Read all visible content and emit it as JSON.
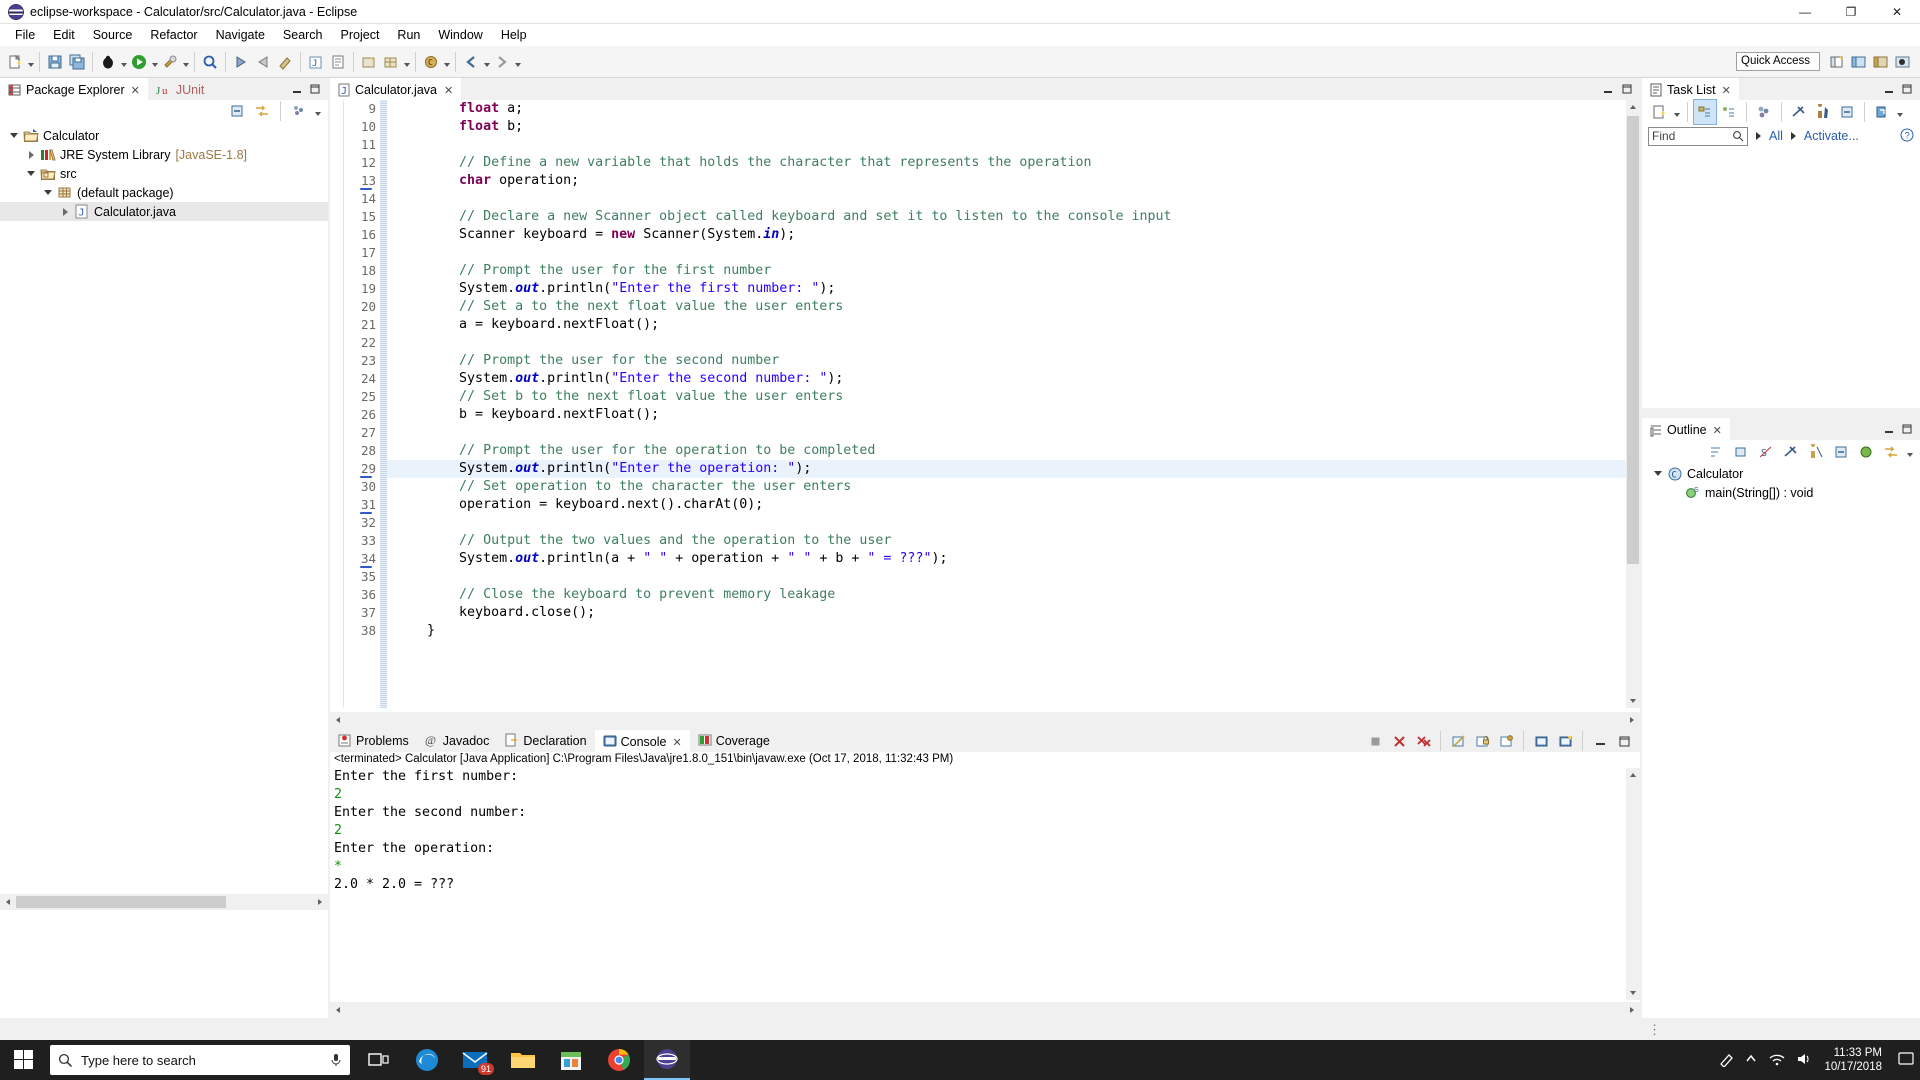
{
  "window": {
    "title": "eclipse-workspace - Calculator/src/Calculator.java - Eclipse",
    "minimize": "—",
    "maximize": "❐",
    "close": "✕"
  },
  "menubar": {
    "items": [
      "File",
      "Edit",
      "Source",
      "Refactor",
      "Navigate",
      "Search",
      "Project",
      "Run",
      "Window",
      "Help"
    ]
  },
  "toolbar": {
    "quick_access_placeholder": "Quick Access"
  },
  "package_explorer": {
    "tabs": [
      {
        "label": "Package Explorer",
        "active": true,
        "icon": "package-explorer-icon"
      },
      {
        "label": "JUnit",
        "active": false,
        "icon": "junit-icon"
      }
    ],
    "tree": [
      {
        "label": "Calculator",
        "sub": "",
        "depth": 0,
        "twisty": "down",
        "icon": "java-project-icon",
        "selected": false
      },
      {
        "label": "JRE System Library",
        "sub": "[JavaSE-1.8]",
        "depth": 1,
        "twisty": "right",
        "icon": "jre-library-icon",
        "selected": false
      },
      {
        "label": "src",
        "sub": "",
        "depth": 1,
        "twisty": "down",
        "icon": "source-folder-icon",
        "selected": false
      },
      {
        "label": "(default package)",
        "sub": "",
        "depth": 2,
        "twisty": "down",
        "icon": "package-icon",
        "selected": false
      },
      {
        "label": "Calculator.java",
        "sub": "",
        "depth": 3,
        "twisty": "right",
        "icon": "java-file-icon",
        "selected": true
      }
    ]
  },
  "editor": {
    "tab": {
      "label": "Calculator.java",
      "icon": "java-file-icon"
    },
    "first_line_number": 9,
    "current_line": 29,
    "changed_lines": [
      13,
      29,
      31,
      34
    ],
    "lines": [
      {
        "n": 9,
        "tokens": [
          {
            "t": "        ",
            "c": ""
          },
          {
            "t": "float",
            "c": "kw"
          },
          {
            "t": " a;",
            "c": ""
          }
        ]
      },
      {
        "n": 10,
        "tokens": [
          {
            "t": "        ",
            "c": ""
          },
          {
            "t": "float",
            "c": "kw"
          },
          {
            "t": " b;",
            "c": ""
          }
        ]
      },
      {
        "n": 11,
        "tokens": []
      },
      {
        "n": 12,
        "tokens": [
          {
            "t": "        ",
            "c": ""
          },
          {
            "t": "// Define a new variable that holds the character that represents the operation",
            "c": "cm"
          }
        ]
      },
      {
        "n": 13,
        "tokens": [
          {
            "t": "        ",
            "c": ""
          },
          {
            "t": "char",
            "c": "kw"
          },
          {
            "t": " operation;",
            "c": ""
          }
        ]
      },
      {
        "n": 14,
        "tokens": []
      },
      {
        "n": 15,
        "tokens": [
          {
            "t": "        ",
            "c": ""
          },
          {
            "t": "// Declare a new Scanner object called keyboard and set it to listen to the console input",
            "c": "cm"
          }
        ]
      },
      {
        "n": 16,
        "tokens": [
          {
            "t": "        Scanner keyboard = ",
            "c": ""
          },
          {
            "t": "new",
            "c": "kw"
          },
          {
            "t": " Scanner(System.",
            "c": ""
          },
          {
            "t": "in",
            "c": "fld"
          },
          {
            "t": ");",
            "c": ""
          }
        ]
      },
      {
        "n": 17,
        "tokens": []
      },
      {
        "n": 18,
        "tokens": [
          {
            "t": "        ",
            "c": ""
          },
          {
            "t": "// Prompt the user for the first number",
            "c": "cm"
          }
        ]
      },
      {
        "n": 19,
        "tokens": [
          {
            "t": "        System.",
            "c": ""
          },
          {
            "t": "out",
            "c": "fld"
          },
          {
            "t": ".println(",
            "c": ""
          },
          {
            "t": "\"Enter the first number: \"",
            "c": "st"
          },
          {
            "t": ");",
            "c": ""
          }
        ]
      },
      {
        "n": 20,
        "tokens": [
          {
            "t": "        ",
            "c": ""
          },
          {
            "t": "// Set a to the next float value the user enters",
            "c": "cm"
          }
        ]
      },
      {
        "n": 21,
        "tokens": [
          {
            "t": "        a = keyboard.nextFloat();",
            "c": ""
          }
        ]
      },
      {
        "n": 22,
        "tokens": []
      },
      {
        "n": 23,
        "tokens": [
          {
            "t": "        ",
            "c": ""
          },
          {
            "t": "// Prompt the user for the second number",
            "c": "cm"
          }
        ]
      },
      {
        "n": 24,
        "tokens": [
          {
            "t": "        System.",
            "c": ""
          },
          {
            "t": "out",
            "c": "fld"
          },
          {
            "t": ".println(",
            "c": ""
          },
          {
            "t": "\"Enter the second number: \"",
            "c": "st"
          },
          {
            "t": ");",
            "c": ""
          }
        ]
      },
      {
        "n": 25,
        "tokens": [
          {
            "t": "        ",
            "c": ""
          },
          {
            "t": "// Set b to the next float value the user enters",
            "c": "cm"
          }
        ]
      },
      {
        "n": 26,
        "tokens": [
          {
            "t": "        b = keyboard.nextFloat();",
            "c": ""
          }
        ]
      },
      {
        "n": 27,
        "tokens": []
      },
      {
        "n": 28,
        "tokens": [
          {
            "t": "        ",
            "c": ""
          },
          {
            "t": "// Prompt the user for the operation to be completed",
            "c": "cm"
          }
        ]
      },
      {
        "n": 29,
        "tokens": [
          {
            "t": "        System.",
            "c": ""
          },
          {
            "t": "out",
            "c": "fld"
          },
          {
            "t": ".println(",
            "c": ""
          },
          {
            "t": "\"Enter the operation: \"",
            "c": "st"
          },
          {
            "t": ");",
            "c": ""
          }
        ]
      },
      {
        "n": 30,
        "tokens": [
          {
            "t": "        ",
            "c": ""
          },
          {
            "t": "// Set operation to the character the user enters",
            "c": "cm"
          }
        ]
      },
      {
        "n": 31,
        "tokens": [
          {
            "t": "        operation = keyboard.next().charAt(0);",
            "c": ""
          }
        ]
      },
      {
        "n": 32,
        "tokens": []
      },
      {
        "n": 33,
        "tokens": [
          {
            "t": "        ",
            "c": ""
          },
          {
            "t": "// Output the two values and the operation to the user",
            "c": "cm"
          }
        ]
      },
      {
        "n": 34,
        "tokens": [
          {
            "t": "        System.",
            "c": ""
          },
          {
            "t": "out",
            "c": "fld"
          },
          {
            "t": ".println(a + ",
            "c": ""
          },
          {
            "t": "\" \"",
            "c": "st"
          },
          {
            "t": " + operation + ",
            "c": ""
          },
          {
            "t": "\" \"",
            "c": "st"
          },
          {
            "t": " + b + ",
            "c": ""
          },
          {
            "t": "\" = ???\"",
            "c": "st"
          },
          {
            "t": ");",
            "c": ""
          }
        ]
      },
      {
        "n": 35,
        "tokens": []
      },
      {
        "n": 36,
        "tokens": [
          {
            "t": "        ",
            "c": ""
          },
          {
            "t": "// Close the keyboard to prevent memory leakage",
            "c": "cm"
          }
        ]
      },
      {
        "n": 37,
        "tokens": [
          {
            "t": "        keyboard.close();",
            "c": ""
          }
        ]
      },
      {
        "n": 38,
        "tokens": [
          {
            "t": "    }",
            "c": ""
          }
        ]
      }
    ]
  },
  "console": {
    "tabs": [
      {
        "label": "Problems",
        "active": false,
        "icon": "problems-icon"
      },
      {
        "label": "Javadoc",
        "active": false,
        "icon": "javadoc-icon"
      },
      {
        "label": "Declaration",
        "active": false,
        "icon": "declaration-icon"
      },
      {
        "label": "Console",
        "active": true,
        "icon": "console-icon"
      },
      {
        "label": "Coverage",
        "active": false,
        "icon": "coverage-icon"
      }
    ],
    "header": "<terminated> Calculator [Java Application] C:\\Program Files\\Java\\jre1.8.0_151\\bin\\javaw.exe (Oct 17, 2018, 11:32:43 PM)",
    "output": [
      {
        "text": "Enter the first number: ",
        "input": false
      },
      {
        "text": "2",
        "input": true
      },
      {
        "text": "Enter the second number: ",
        "input": false
      },
      {
        "text": "2",
        "input": true
      },
      {
        "text": "Enter the operation: ",
        "input": false
      },
      {
        "text": "*",
        "input": true
      },
      {
        "text": "2.0 * 2.0 = ???",
        "input": false
      }
    ]
  },
  "task_list": {
    "tab": {
      "label": "Task List",
      "icon": "task-list-icon"
    },
    "find_placeholder": "Find",
    "all_label": "All",
    "activate_label": "Activate..."
  },
  "outline": {
    "tab": {
      "label": "Outline",
      "icon": "outline-icon"
    },
    "rows": [
      {
        "label": "Calculator",
        "depth": 0,
        "twisty": "down",
        "icon": "java-class-icon"
      },
      {
        "label": "main(String[]) : void",
        "depth": 1,
        "twisty": "none",
        "icon": "method-public-icon"
      }
    ]
  },
  "taskbar": {
    "search_placeholder": "Type here to search",
    "clock_time": "11:33 PM",
    "clock_date": "10/17/2018",
    "mail_badge": "91",
    "apps": [
      {
        "name": "task-view-icon"
      },
      {
        "name": "edge-icon"
      },
      {
        "name": "mail-icon"
      },
      {
        "name": "file-explorer-icon"
      },
      {
        "name": "store-icon"
      },
      {
        "name": "chrome-icon"
      },
      {
        "name": "eclipse-icon"
      }
    ]
  },
  "colors": {
    "keyword": "#7f0055",
    "comment": "#3f7f5f",
    "string": "#2a00ff",
    "field": "#0000c0",
    "console_input": "#109010",
    "accent_blue": "#2a5db0",
    "current_line": "#eaf2fb"
  }
}
